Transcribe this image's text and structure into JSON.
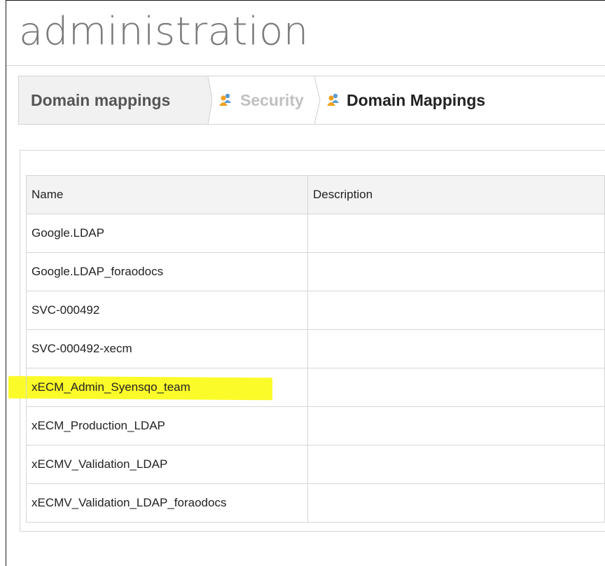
{
  "page": {
    "title": "administration"
  },
  "breadcrumb": {
    "items": [
      {
        "label": "Domain mappings"
      },
      {
        "label": "Security"
      },
      {
        "label": "Domain Mappings"
      }
    ]
  },
  "table": {
    "columns": [
      "Name",
      "Description"
    ],
    "rows": [
      {
        "name": "Google.LDAP",
        "description": ""
      },
      {
        "name": "Google.LDAP_foraodocs",
        "description": ""
      },
      {
        "name": "SVC-000492",
        "description": ""
      },
      {
        "name": "SVC-000492-xecm",
        "description": ""
      },
      {
        "name": "xECM_Admin_Syensqo_team",
        "description": "",
        "highlighted": true
      },
      {
        "name": "xECM_Production_LDAP",
        "description": ""
      },
      {
        "name": "xECMV_Validation_LDAP",
        "description": ""
      },
      {
        "name": "xECMV_Validation_LDAP_foraodocs",
        "description": ""
      }
    ]
  },
  "colors": {
    "highlight": "#fbfb2a",
    "title": "#7a7a7a",
    "border": "#d6d6d6",
    "header_bg": "#f3f3f3",
    "crumb_icon": "#f0a020"
  },
  "icons": {
    "breadcrumb_item": "users-group-icon"
  }
}
